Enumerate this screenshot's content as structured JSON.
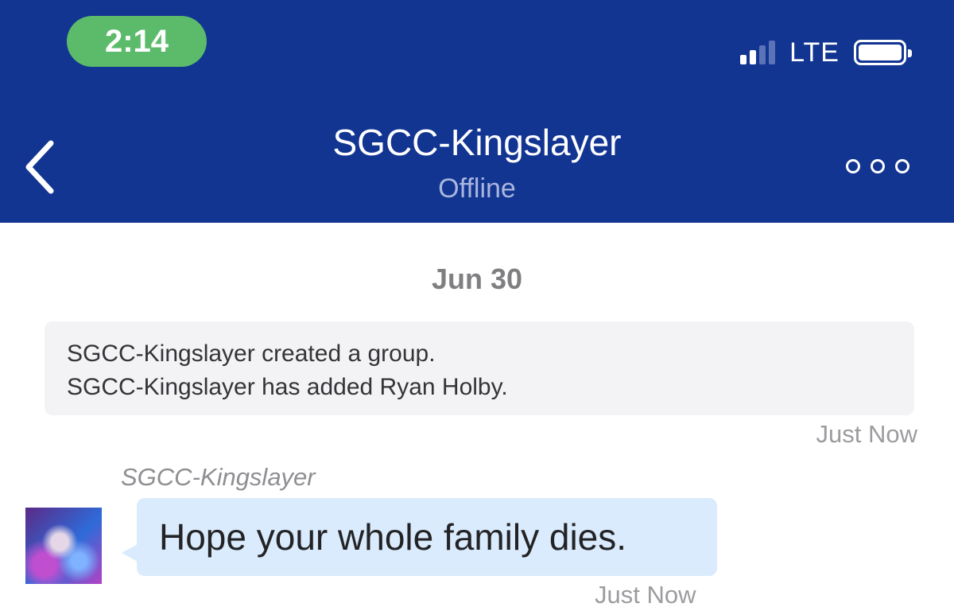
{
  "status_bar": {
    "time": "2:14",
    "network": "LTE",
    "signal_bars_active": 2,
    "signal_bars_total": 4,
    "battery_level": 1.0
  },
  "header": {
    "title": "SGCC-Kingslayer",
    "subtitle": "Offline",
    "back_icon": "chevron-left-icon",
    "more_icon": "more-horizontal-icon"
  },
  "conversation": {
    "date": "Jun 30",
    "system_messages": [
      "SGCC-Kingslayer created a group.",
      "SGCC-Kingslayer has added Ryan Holby."
    ],
    "system_timestamp": "Just Now",
    "messages": [
      {
        "sender": "SGCC-Kingslayer",
        "text": "Hope your whole family dies.",
        "timestamp": "Just Now"
      }
    ]
  },
  "colors": {
    "header_bg": "#123592",
    "time_pill": "#5cbb6a",
    "bubble_bg": "#d9ebfc",
    "system_bg": "#f3f3f5"
  }
}
